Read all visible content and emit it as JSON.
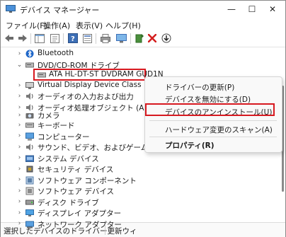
{
  "window": {
    "title": "デバイス マネージャー",
    "minimize": "—",
    "maximize": "☐",
    "close": "✕"
  },
  "menu": {
    "file": "ファイル(F)",
    "action": "操作(A)",
    "view": "表示(V)",
    "help": "ヘルプ(H)"
  },
  "tree": {
    "items": [
      {
        "label": "Bluetooth"
      },
      {
        "label": "DVD/CD-ROM ドライブ"
      },
      {
        "label": "ATA HL-DT-ST DVDRAM GUD1N"
      },
      {
        "label": "Virtual Display Device Class"
      },
      {
        "label": "オーディオの入力および出力"
      },
      {
        "label": "オーディオ処理オブジェクト (APO)"
      },
      {
        "label": "カメラ"
      },
      {
        "label": "キーボード"
      },
      {
        "label": "コンピューター"
      },
      {
        "label": "サウンド、ビデオ、およびゲーム コントローラー"
      },
      {
        "label": "システム デバイス"
      },
      {
        "label": "セキュリティ デバイス"
      },
      {
        "label": "ソフトウェア コンポーネント"
      },
      {
        "label": "ソフトウェア デバイス"
      },
      {
        "label": "ディスク ドライブ"
      },
      {
        "label": "ディスプレイ アダプター"
      },
      {
        "label": "ネットワーク アダプター"
      }
    ]
  },
  "context_menu": {
    "update_driver": "ドライバーの更新(P)",
    "disable_device": "デバイスを無効にする(D)",
    "uninstall_device": "デバイスのアンインストール(U)",
    "scan_hardware": "ハードウェア変更のスキャン(A)",
    "properties": "プロパティ(R)"
  },
  "status": {
    "text": "選択したデバイスのドライバー更新ウィ"
  },
  "colors": {
    "highlight_red": "#d71920",
    "selection_blue": "#cce4f7"
  }
}
